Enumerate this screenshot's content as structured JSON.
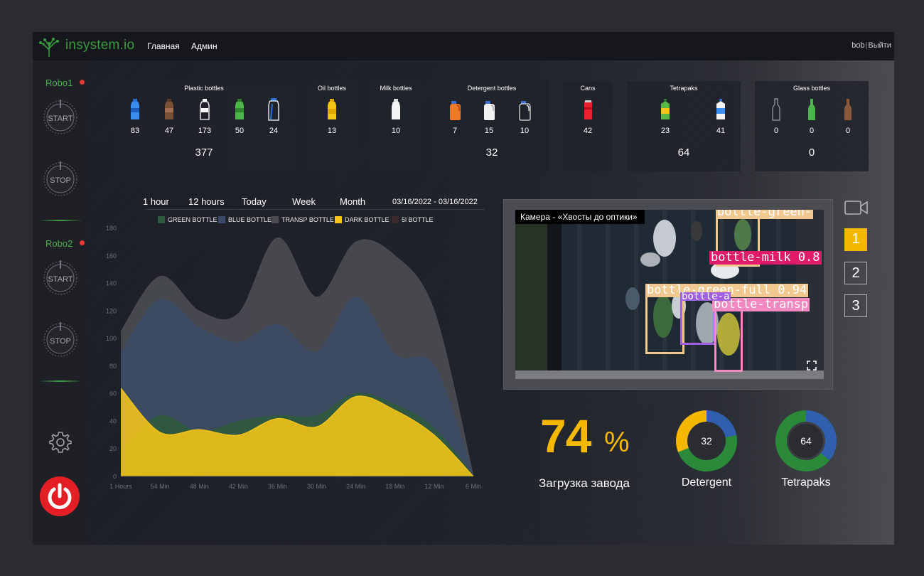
{
  "app": {
    "logo_text": "insystem.io",
    "nav": [
      "Главная",
      "Админ"
    ],
    "user": "bob",
    "logout": "Выйти"
  },
  "sidebar": {
    "robots": [
      {
        "label": "Robo1",
        "start": "START",
        "stop": "STOP",
        "status_color": "#e53935"
      },
      {
        "label": "Robo2",
        "start": "START",
        "stop": "STOP",
        "status_color": "#e53935"
      }
    ],
    "icons": [
      "gear-icon",
      "power-icon"
    ]
  },
  "categories": [
    {
      "title": "Plastic bottles",
      "counts": [
        "83",
        "47",
        "173",
        "50",
        "24"
      ],
      "total": "377"
    },
    {
      "title": "Oil bottles",
      "counts": [
        "13"
      ],
      "total": ""
    },
    {
      "title": "Milk bottles",
      "counts": [
        "10"
      ],
      "total": ""
    },
    {
      "title": "Detergent bottles",
      "counts": [
        "7",
        "15",
        "10"
      ],
      "total": "32"
    },
    {
      "title": "Cans",
      "counts": [
        "42"
      ],
      "total": ""
    },
    {
      "title": "Tetrapaks",
      "counts": [
        "23",
        "41"
      ],
      "total": "64"
    },
    {
      "title": "Glass bottles",
      "counts": [
        "0",
        "0",
        "0"
      ],
      "total": "0"
    }
  ],
  "time_filters": [
    "1 hour",
    "12 hours",
    "Today",
    "Week",
    "Month"
  ],
  "date_range": "03/16/2022 - 03/16/2022",
  "chart_data": {
    "type": "area",
    "categories": [
      "1 Hours",
      "54 Min",
      "48 Min",
      "42 Min",
      "36 Min",
      "30 Min",
      "24 Min",
      "18 Min",
      "12 Min",
      "6 Min"
    ],
    "ylim": [
      0,
      180
    ],
    "yticks": [
      0,
      20,
      40,
      60,
      80,
      100,
      120,
      140,
      160,
      180
    ],
    "grid": false,
    "legend_position": "top",
    "series": [
      {
        "name": "GREEN BOTTLE",
        "color": "#2e5a3e",
        "values": [
          20,
          44,
          32,
          40,
          44,
          44,
          60,
          52,
          35,
          0
        ]
      },
      {
        "name": "BLUE BOTTLE",
        "color": "#3a4c6a",
        "values": [
          90,
          128,
          108,
          97,
          110,
          90,
          130,
          88,
          80,
          0
        ]
      },
      {
        "name": "TRANSP BOTTLE",
        "color": "#4a4c52",
        "values": [
          105,
          145,
          120,
          118,
          173,
          130,
          170,
          160,
          120,
          0
        ]
      },
      {
        "name": "DARK BOTTLE",
        "color": "#f5c518",
        "values": [
          64,
          32,
          34,
          30,
          42,
          36,
          58,
          48,
          30,
          0
        ]
      },
      {
        "name": "5l BOTTLE",
        "color": "#3a2a2c",
        "values": [
          0,
          0,
          0,
          0,
          0,
          0,
          0,
          0,
          0,
          0
        ]
      }
    ]
  },
  "camera": {
    "title": "Камера - «Хвосты до оптики»",
    "detections": [
      "bottle-green-",
      "bottle-milk 0.8",
      "bottle-green-full 0.94",
      "bottle-transp",
      "bottle-a"
    ],
    "buttons": [
      "1",
      "2",
      "3"
    ],
    "active": "1"
  },
  "load": {
    "value": "74",
    "unit": "%",
    "label": "Загрузка завода"
  },
  "donuts": [
    {
      "value": "32",
      "label": "Detergent",
      "segments": [
        {
          "color": "#2f5fad",
          "fraction": 0.22
        },
        {
          "color": "#2a8a3a",
          "fraction": 0.47
        },
        {
          "color": "#f5b800",
          "fraction": 0.31
        }
      ]
    },
    {
      "value": "64",
      "label": "Tetrapaks",
      "segments": [
        {
          "color": "#2f5fad",
          "fraction": 0.36
        },
        {
          "color": "#2a8a3a",
          "fraction": 0.64
        }
      ]
    }
  ]
}
